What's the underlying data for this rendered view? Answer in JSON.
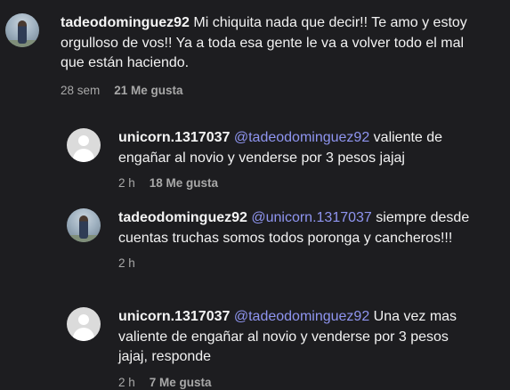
{
  "comments": [
    {
      "username": "tadeodominguez92",
      "mention": "",
      "text": "Mi chiquita nada que decir!! Te amo y estoy orgulloso de vos!! Ya a toda esa gente le va a volver todo el mal que están haciendo.",
      "time": "28 sem",
      "likes": "21 Me gusta",
      "avatar": "photo-avatar"
    },
    {
      "username": "unicorn.1317037",
      "mention": "@tadeodominguez92",
      "text": "valiente de engañar al novio y venderse por 3 pesos jajaj",
      "time": "2 h",
      "likes": "18 Me gusta",
      "avatar": "default-avatar"
    },
    {
      "username": "tadeodominguez92",
      "mention": "@unicorn.1317037",
      "text": "siempre desde cuentas truchas somos todos poronga y cancheros!!!",
      "time": "2 h",
      "likes": "",
      "avatar": "photo-avatar"
    },
    {
      "username": "unicorn.1317037",
      "mention": "@tadeodominguez92",
      "text": "Una vez mas valiente de engañar al novio y venderse por 3 pesos jajaj, responde",
      "time": "2 h",
      "likes": "7 Me gusta",
      "avatar": "default-avatar"
    }
  ],
  "colors": {
    "background": "#1d1d20",
    "text": "#f2f2f2",
    "mention": "#8f95f0",
    "meta": "#a8a8a8"
  }
}
